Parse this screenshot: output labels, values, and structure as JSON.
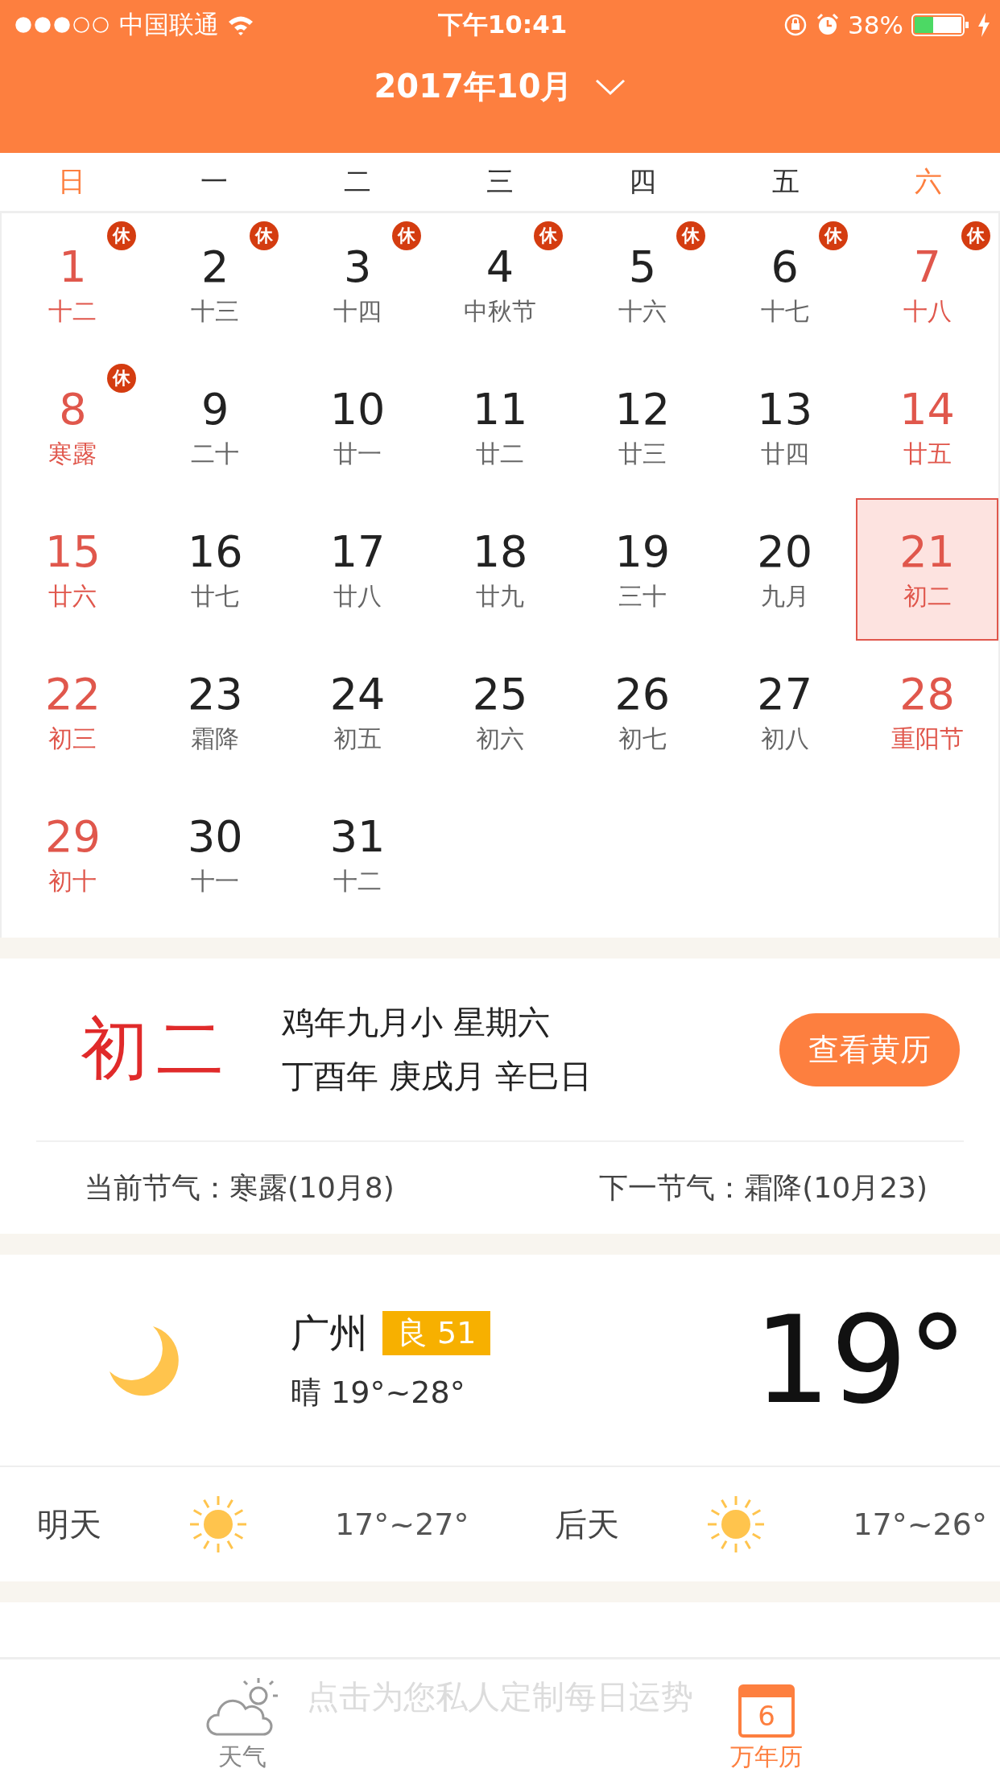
{
  "status_bar": {
    "carrier": "中国联通",
    "time": "下午10:41",
    "battery": "38%"
  },
  "header": {
    "title": "2017年10月"
  },
  "weekdays": [
    "日",
    "一",
    "二",
    "三",
    "四",
    "五",
    "六"
  ],
  "days": [
    {
      "day": "1",
      "lunar": "十二",
      "badge": "休",
      "selected": false
    },
    {
      "day": "2",
      "lunar": "十三",
      "badge": "休",
      "selected": false
    },
    {
      "day": "3",
      "lunar": "十四",
      "badge": "休",
      "selected": false
    },
    {
      "day": "4",
      "lunar": "中秋节",
      "badge": "休",
      "selected": false
    },
    {
      "day": "5",
      "lunar": "十六",
      "badge": "休",
      "selected": false
    },
    {
      "day": "6",
      "lunar": "十七",
      "badge": "休",
      "selected": false
    },
    {
      "day": "7",
      "lunar": "十八",
      "badge": "休",
      "selected": false
    },
    {
      "day": "8",
      "lunar": "寒露",
      "badge": "休",
      "selected": false
    },
    {
      "day": "9",
      "lunar": "二十",
      "selected": false
    },
    {
      "day": "10",
      "lunar": "廿一",
      "selected": false
    },
    {
      "day": "11",
      "lunar": "廿二",
      "selected": false
    },
    {
      "day": "12",
      "lunar": "廿三",
      "selected": false
    },
    {
      "day": "13",
      "lunar": "廿四",
      "selected": false
    },
    {
      "day": "14",
      "lunar": "廿五",
      "selected": false
    },
    {
      "day": "15",
      "lunar": "廿六",
      "selected": false
    },
    {
      "day": "16",
      "lunar": "廿七",
      "selected": false
    },
    {
      "day": "17",
      "lunar": "廿八",
      "selected": false
    },
    {
      "day": "18",
      "lunar": "廿九",
      "selected": false
    },
    {
      "day": "19",
      "lunar": "三十",
      "selected": false
    },
    {
      "day": "20",
      "lunar": "九月",
      "selected": false
    },
    {
      "day": "21",
      "lunar": "初二",
      "selected": true
    },
    {
      "day": "22",
      "lunar": "初三",
      "selected": false
    },
    {
      "day": "23",
      "lunar": "霜降",
      "selected": false
    },
    {
      "day": "24",
      "lunar": "初五",
      "selected": false
    },
    {
      "day": "25",
      "lunar": "初六",
      "selected": false
    },
    {
      "day": "26",
      "lunar": "初七",
      "selected": false
    },
    {
      "day": "27",
      "lunar": "初八",
      "selected": false
    },
    {
      "day": "28",
      "lunar": "重阳节",
      "selected": false
    },
    {
      "day": "29",
      "lunar": "初十",
      "selected": false
    },
    {
      "day": "30",
      "lunar": "十一",
      "selected": false
    },
    {
      "day": "31",
      "lunar": "十二",
      "selected": false
    }
  ],
  "almanac": {
    "lunar_day": "初二",
    "line_1": "鸡年九月小 星期六",
    "line_2": "丁酉年 庚戌月 辛巳日",
    "button": "查看黄历",
    "current_term": "当前节气：寒露(10月8)",
    "next_term": "下一节气：霜降(10月23)"
  },
  "weather": {
    "city": "广州",
    "aqi": "良 51",
    "condition": "晴  19°~28°",
    "temperature": "19°",
    "forecast": [
      {
        "day": "明天",
        "range": "17°~27°"
      },
      {
        "day": "后天",
        "range": "17°~26°"
      }
    ]
  },
  "promo": "点击为您私人定制每日运势",
  "tabs": [
    {
      "label": "天气",
      "kind": "weather",
      "selected": false
    },
    {
      "label": "万年历",
      "kind": "calendar",
      "icon_text": "6",
      "selected": true
    }
  ]
}
